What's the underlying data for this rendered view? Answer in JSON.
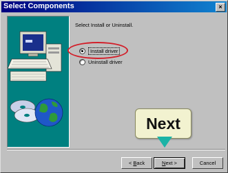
{
  "window": {
    "title": "Select Components",
    "close_glyph": "×"
  },
  "content": {
    "heading": "Select Install or Uninstall.",
    "options": [
      {
        "label": "Install driver",
        "checked": true
      },
      {
        "label": "Uninstall driver",
        "checked": false
      }
    ]
  },
  "buttons": {
    "back": {
      "pre": "< ",
      "u": "B",
      "post": "ack"
    },
    "next": {
      "u": "N",
      "post": "ext >"
    },
    "cancel": "Cancel"
  },
  "annotation": {
    "callout_text": "Next",
    "highlight_color": "#d21f2a",
    "arrow_color": "#1bb3a6"
  },
  "colors": {
    "titlebar_start": "#000080",
    "titlebar_end": "#1084d0",
    "art_background": "#008080"
  }
}
